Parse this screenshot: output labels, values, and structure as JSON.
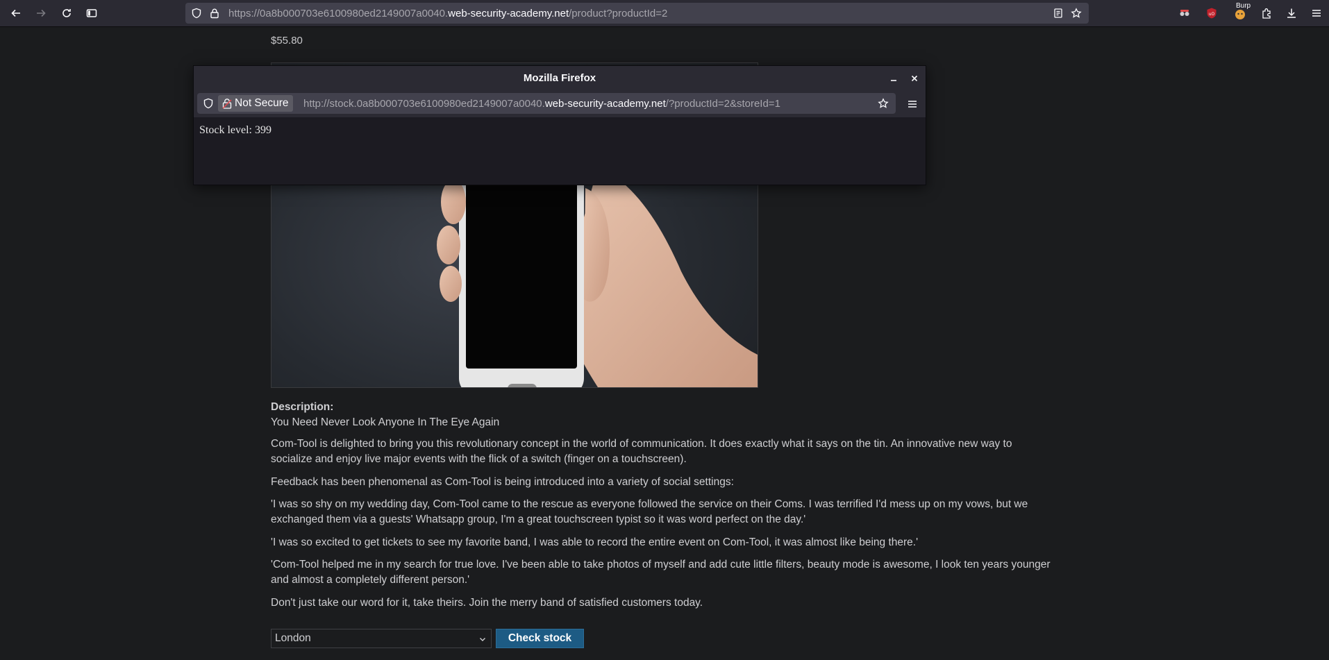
{
  "browser": {
    "url_prefix": "https://0a8b000703e6100980ed2149007a0040.",
    "url_domain": "web-security-academy.net",
    "url_path": "/product?productId=2",
    "extension_badge": "Burp"
  },
  "page": {
    "price": "$55.80",
    "description_label": "Description:",
    "tagline": "You Need Never Look Anyone In The Eye Again",
    "paragraphs": {
      "p1": "Com-Tool is delighted to bring you this revolutionary concept in the world of communication. It does exactly what it says on the tin. An innovative new way to socialize and enjoy live major events with the flick of a switch (finger on a touchscreen).",
      "p2": "Feedback has been phenomenal as Com-Tool is being introduced into a variety of social settings:",
      "p3": "'I was so shy on my wedding day, Com-Tool came to the rescue as everyone followed the service on their Coms. I was terrified I'd mess up on my vows, but we exchanged them via a guests' Whatsapp group, I'm a great touchscreen typist so it was word perfect on the day.'",
      "p4": "'I was so excited to get tickets to see my favorite band, I was able to record the entire event on Com-Tool, it was almost like being there.'",
      "p5": "'Com-Tool helped me in my search for true love. I've been able to take photos of myself and add cute little filters, beauty mode is awesome, I look ten years younger and almost a completely different person.'",
      "p6": "Don't just take our word for it, take theirs. Join the merry band of satisfied customers today."
    },
    "store_select_value": "London",
    "check_stock_label": "Check stock"
  },
  "popup": {
    "title": "Mozilla Firefox",
    "not_secure_label": "Not Secure",
    "url_prefix": "http://stock.0a8b000703e6100980ed2149007a0040.",
    "url_domain": "web-security-academy.net",
    "url_path": "/?productId=2&storeId=1",
    "body_text": "Stock level: 399"
  },
  "colors": {
    "toolbar_bg": "#2b2a33",
    "urlbar_bg": "#42414d",
    "page_bg": "#1b1c1e",
    "button_bg": "#1d5b84"
  }
}
